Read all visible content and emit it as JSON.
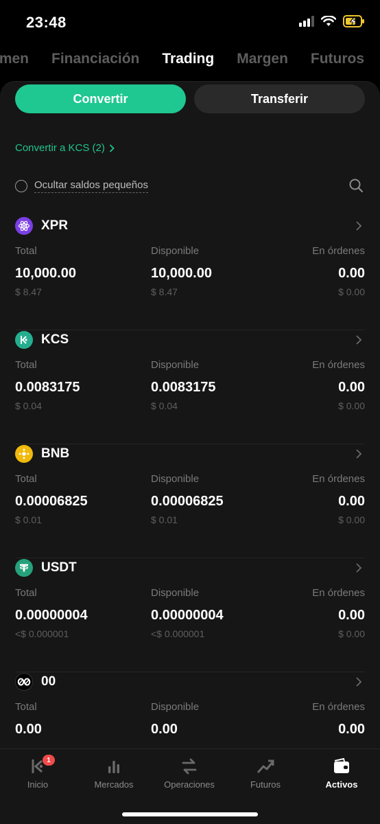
{
  "status": {
    "time": "23:48"
  },
  "top_tabs": [
    {
      "label": "umen",
      "active": false
    },
    {
      "label": "Financiación",
      "active": false
    },
    {
      "label": "Trading",
      "active": true
    },
    {
      "label": "Margen",
      "active": false
    },
    {
      "label": "Futuros",
      "active": false
    }
  ],
  "actions": {
    "convert_label": "Convertir",
    "transfer_label": "Transferir"
  },
  "convert_link": "Convertir a KCS (2)",
  "hide_small": "Ocultar saldos pequeños",
  "column_labels": {
    "total": "Total",
    "available": "Disponible",
    "in_orders": "En órdenes"
  },
  "assets": [
    {
      "symbol": "XPR",
      "icon": "xpr-icon",
      "total": "10,000.00",
      "total_usd": "$ 8.47",
      "available": "10,000.00",
      "available_usd": "$ 8.47",
      "orders": "0.00",
      "orders_usd": "$ 0.00"
    },
    {
      "symbol": "KCS",
      "icon": "kcs-icon",
      "total": "0.0083175",
      "total_usd": "$ 0.04",
      "available": "0.0083175",
      "available_usd": "$ 0.04",
      "orders": "0.00",
      "orders_usd": "$ 0.00"
    },
    {
      "symbol": "BNB",
      "icon": "bnb-icon",
      "total": "0.00006825",
      "total_usd": "$ 0.01",
      "available": "0.00006825",
      "available_usd": "$ 0.01",
      "orders": "0.00",
      "orders_usd": "$ 0.00"
    },
    {
      "symbol": "USDT",
      "icon": "usdt-icon",
      "total": "0.00000004",
      "total_usd": "<$ 0.000001",
      "available": "0.00000004",
      "available_usd": "<$ 0.000001",
      "orders": "0.00",
      "orders_usd": "$ 0.00"
    },
    {
      "symbol": "00",
      "icon": "00-icon",
      "total": "0.00",
      "total_usd": "",
      "available": "0.00",
      "available_usd": "",
      "orders": "0.00",
      "orders_usd": ""
    }
  ],
  "tabbar": [
    {
      "label": "Inicio",
      "icon": "kucoin-home-icon",
      "badge": "1",
      "active": false
    },
    {
      "label": "Mercados",
      "icon": "bar-chart-icon",
      "active": false
    },
    {
      "label": "Operaciones",
      "icon": "swap-arrows-icon",
      "active": false
    },
    {
      "label": "Futuros",
      "icon": "trend-up-icon",
      "active": false
    },
    {
      "label": "Activos",
      "icon": "wallet-icon",
      "active": true
    }
  ],
  "colors": {
    "accent": "#1fc890",
    "background": "#000000",
    "sheet": "#161616"
  }
}
